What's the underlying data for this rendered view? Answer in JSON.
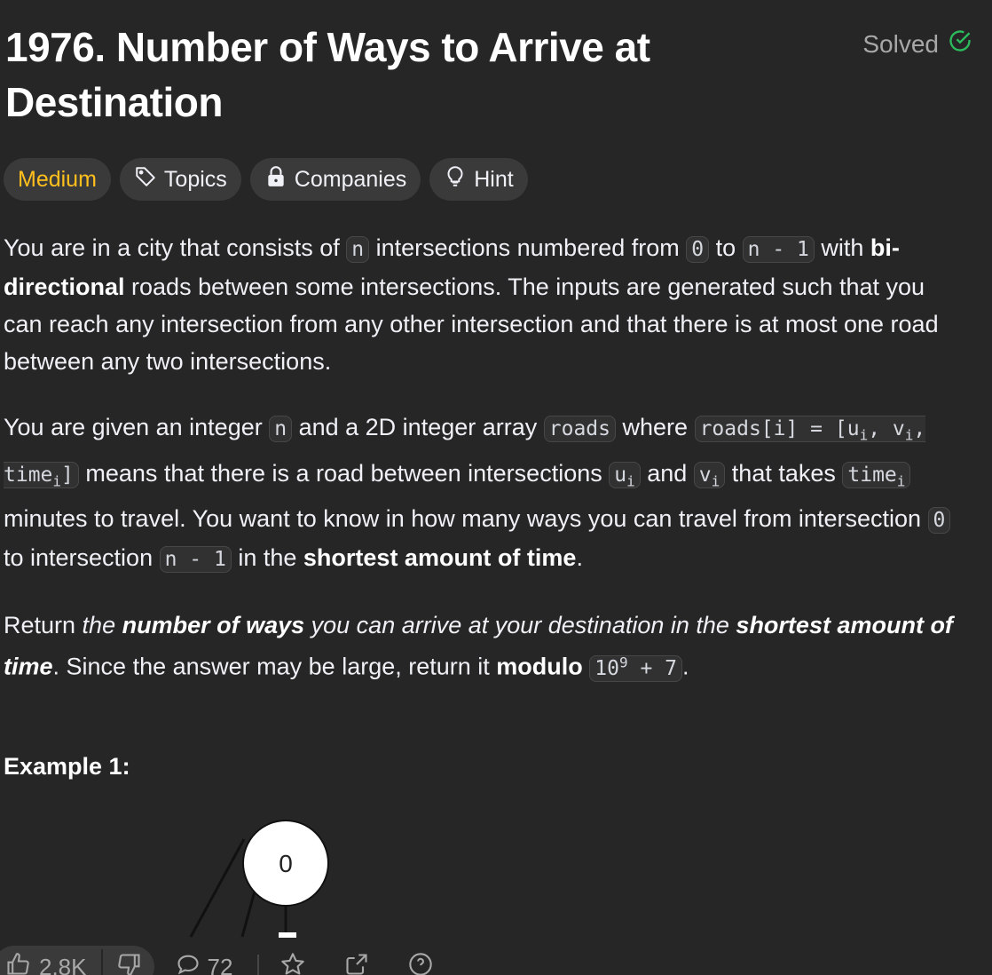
{
  "problem": {
    "title": "1976. Number of Ways to Arrive at Destination",
    "solved_label": "Solved"
  },
  "tags": {
    "difficulty": "Medium",
    "topics": "Topics",
    "companies": "Companies",
    "hint": "Hint"
  },
  "description": {
    "p1": {
      "t1": "You are in a city that consists of ",
      "c1": "n",
      "t2": " intersections numbered from ",
      "c2": "0",
      "t3": " to ",
      "c3": "n - 1",
      "t4": " with ",
      "b1": "bi-directional",
      "t5": " roads between some intersections. The inputs are generated such that you can reach any intersection from any other intersection and that there is at most one road between any two intersections."
    },
    "p2": {
      "t1": "You are given an integer ",
      "c1": "n",
      "t2": " and a 2D integer array ",
      "c2": "roads",
      "t3": " where ",
      "c3a": "roads[i] = [u",
      "c3sub1": "i",
      "c3b": ", v",
      "c3sub2": "i",
      "c3c": ", time",
      "c3sub3": "i",
      "c3d": "]",
      "t4": " means that there is a road between intersections ",
      "c4a": "u",
      "c4sub": "i",
      "t5": " and ",
      "c5a": "v",
      "c5sub": "i",
      "t6": " that takes ",
      "c6a": "time",
      "c6sub": "i",
      "t7": " minutes to travel. You want to know in how many ways you can travel from intersection ",
      "c7": "0",
      "t8": " to intersection ",
      "c8": "n - 1",
      "t9": " in the ",
      "b1": "shortest amount of time",
      "t10": "."
    },
    "p3": {
      "t1": "Return ",
      "i1": "the ",
      "bi1": "number of ways",
      "i2": " you can arrive at your destination in the ",
      "bi2": "shortest amount of time",
      "t2": ". Since the answer may be large, return it ",
      "b1": "modulo",
      "t3": " ",
      "c1a": "10",
      "c1sup": "9",
      "c1b": " + 7",
      "t4": "."
    }
  },
  "example": {
    "heading": "Example 1:",
    "node_label": "0"
  },
  "footer": {
    "likes": "2.8K",
    "comments": "72"
  },
  "colors": {
    "background": "#262626",
    "medium": "#ffc01e",
    "solved_check": "#2cbb5d",
    "tag_bg": "#3a3a3a"
  }
}
